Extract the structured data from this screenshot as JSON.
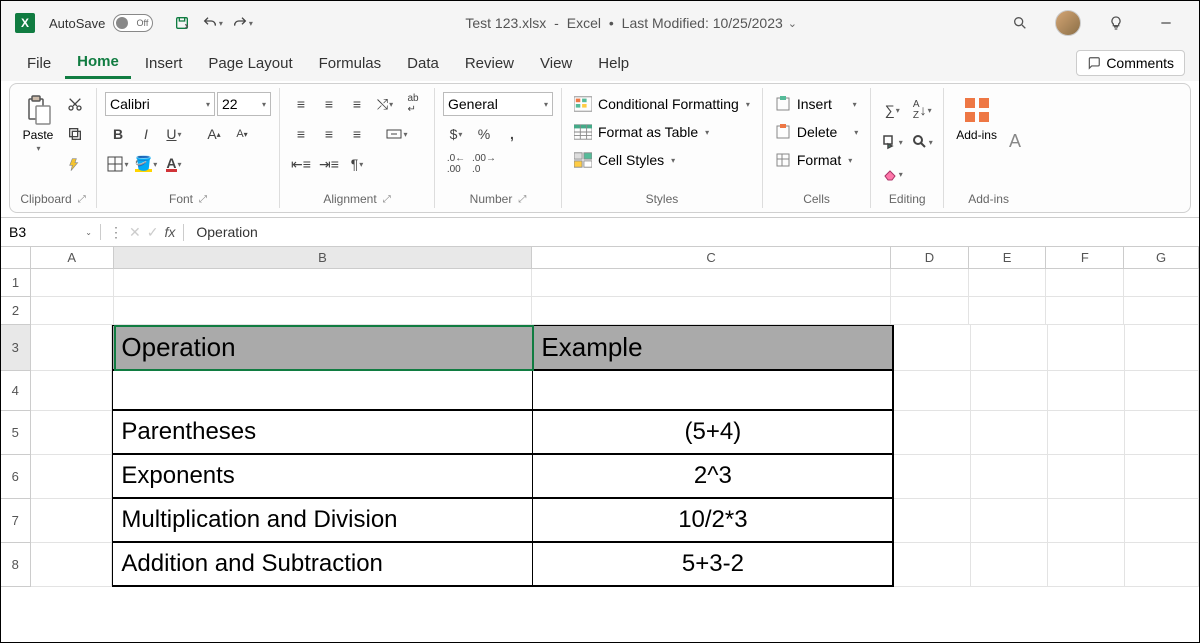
{
  "titlebar": {
    "autosave_label": "AutoSave",
    "autosave_state": "Off",
    "filename": "Test 123.xlsx",
    "app": "Excel",
    "modified": "Last Modified: 10/25/2023"
  },
  "tabs": [
    "File",
    "Home",
    "Insert",
    "Page Layout",
    "Formulas",
    "Data",
    "Review",
    "View",
    "Help"
  ],
  "active_tab": "Home",
  "comments_label": "Comments",
  "ribbon": {
    "clipboard": {
      "paste": "Paste",
      "label": "Clipboard"
    },
    "font": {
      "name": "Calibri",
      "size": "22",
      "label": "Font"
    },
    "alignment": {
      "label": "Alignment"
    },
    "number": {
      "format": "General",
      "label": "Number"
    },
    "styles": {
      "cf": "Conditional Formatting",
      "fat": "Format as Table",
      "cs": "Cell Styles",
      "label": "Styles"
    },
    "cells": {
      "insert": "Insert",
      "delete": "Delete",
      "format": "Format",
      "label": "Cells"
    },
    "editing": {
      "label": "Editing"
    },
    "addins": {
      "big": "Add-ins",
      "label": "Add-ins"
    }
  },
  "namebox": "B3",
  "formula_value": "Operation",
  "columns": [
    "A",
    "B",
    "C",
    "D",
    "E",
    "F",
    "G"
  ],
  "rows": [
    "1",
    "2",
    "3",
    "4",
    "5",
    "6",
    "7",
    "8"
  ],
  "table": {
    "h1": "Operation",
    "h2": "Example",
    "r1a": "Parentheses",
    "r1b": "(5+4)",
    "r2a": "Exponents",
    "r2b": "2^3",
    "r3a": "Multiplication and Division",
    "r3b": "10/2*3",
    "r4a": "Addition and Subtraction",
    "r4b": "5+3-2"
  }
}
